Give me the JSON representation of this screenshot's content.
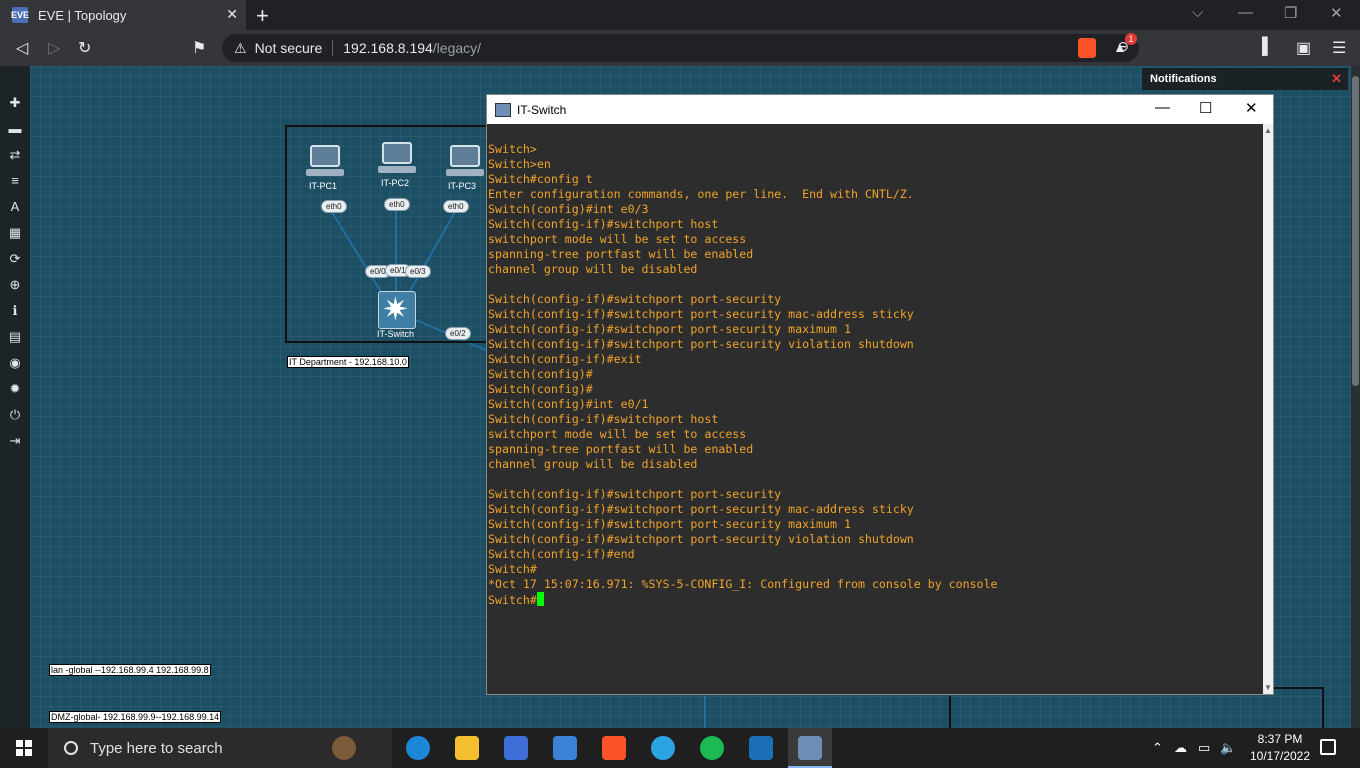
{
  "browser": {
    "tab_title": "EVE | Topology",
    "tab_favicon": "EVE",
    "tab_close": "✕",
    "new_tab": "+",
    "address_warning": "Not secure",
    "url_host": "192.168.8.194",
    "url_path": "/legacy/",
    "brave_badge": "1"
  },
  "window_controls": {
    "minimize": "⌵",
    "restore": "—",
    "maximize": "❐",
    "close": "✕"
  },
  "notifications": {
    "title": "Notifications",
    "close": "✕"
  },
  "topology": {
    "nodes": [
      {
        "label": "IT-PC1",
        "iface": "eth0"
      },
      {
        "label": "IT-PC2",
        "iface": "eth0"
      },
      {
        "label": "IT-PC3",
        "iface": "eth0"
      }
    ],
    "switch_label": "IT-Switch",
    "switch_ifaces": [
      "e0/0",
      "e0/1",
      "e0/3",
      "e0/2"
    ],
    "group_label": "IT Department - 192.168.10.0",
    "labels": [
      "lan -global --192.168.99.4 192.168.99.8",
      "DMZ-global- 192.168.99.9--192.168.99.14"
    ]
  },
  "terminal": {
    "title": "IT-Switch",
    "lines": [
      "Switch>",
      "Switch>en",
      "Switch#config t",
      "Enter configuration commands, one per line.  End with CNTL/Z.",
      "Switch(config)#int e0/3",
      "Switch(config-if)#switchport host",
      "switchport mode will be set to access",
      "spanning-tree portfast will be enabled",
      "channel group will be disabled",
      "",
      "Switch(config-if)#switchport port-security",
      "Switch(config-if)#switchport port-security mac-address sticky",
      "Switch(config-if)#switchport port-security maximum 1",
      "Switch(config-if)#switchport port-security violation shutdown",
      "Switch(config-if)#exit",
      "Switch(config)#",
      "Switch(config)#",
      "Switch(config)#int e0/1",
      "Switch(config-if)#switchport host",
      "switchport mode will be set to access",
      "spanning-tree portfast will be enabled",
      "channel group will be disabled",
      "",
      "Switch(config-if)#switchport port-security",
      "Switch(config-if)#switchport port-security mac-address sticky",
      "Switch(config-if)#switchport port-security maximum 1",
      "Switch(config-if)#switchport port-security violation shutdown",
      "Switch(config-if)#end",
      "Switch#",
      "*Oct 17 15:07:16.971: %SYS-5-CONFIG_I: Configured from console by console"
    ],
    "prompt": "Switch#"
  },
  "taskbar": {
    "search_placeholder": "Type here to search",
    "time": "8:37 PM",
    "date": "10/17/2022"
  },
  "sidebar_icons": [
    "plus-icon",
    "add-object-icon",
    "links-icon",
    "list-icon",
    "text-icon",
    "grid-icon",
    "refresh-icon",
    "zoom-icon",
    "info-icon",
    "logs-icon",
    "status-icon",
    "settings-icon",
    "power-icon",
    "logout-icon"
  ]
}
